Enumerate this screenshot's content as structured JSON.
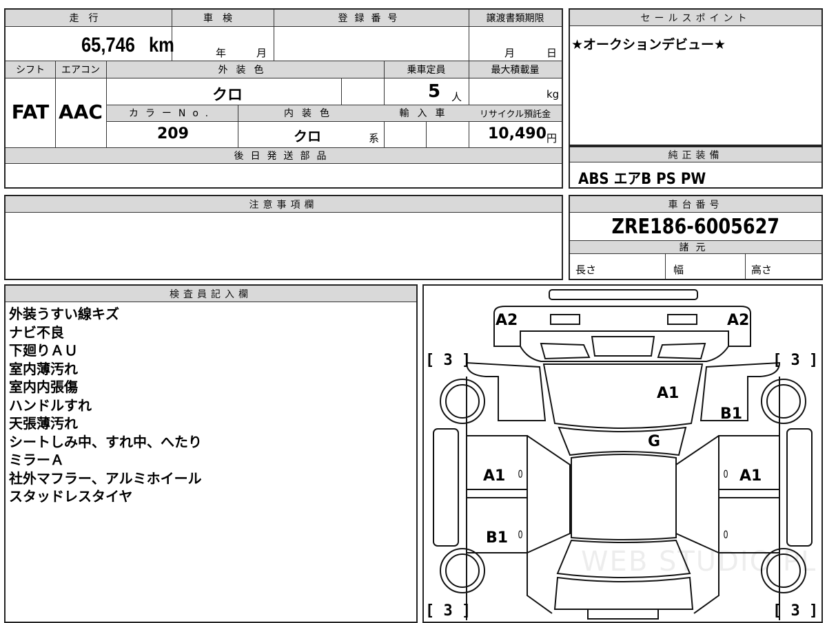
{
  "mileage": {
    "label": "走行",
    "value": "65,746",
    "unit": "km"
  },
  "shaken": {
    "label": "車検",
    "year_unit": "年",
    "month_unit": "月"
  },
  "registration": {
    "label": "登録番号"
  },
  "transfer_deadline": {
    "label": "譲渡書類期限",
    "month_unit": "月",
    "day_unit": "日"
  },
  "shift": {
    "label": "シフト",
    "value": "FAT"
  },
  "aircon": {
    "label": "エアコン",
    "value": "AAC"
  },
  "exterior_color": {
    "label": "外装色",
    "value": "クロ"
  },
  "capacity": {
    "label": "乗車定員",
    "value": "5",
    "unit": "人"
  },
  "max_load": {
    "label": "最大積載量",
    "unit": "kg"
  },
  "color_no": {
    "label": "カラーNo.",
    "value": "209"
  },
  "interior_color": {
    "label": "内装色",
    "value": "クロ",
    "suffix": "系"
  },
  "import": {
    "label": "輸入車"
  },
  "recycle": {
    "label": "リサイクル預託金",
    "value": "10,490",
    "unit": "円"
  },
  "later_parts": {
    "label": "後日発送部品"
  },
  "sales_point": {
    "label": "セールスポイント",
    "text": "★オークションデビュー★"
  },
  "equipment": {
    "label": "純正装備",
    "text": "ABS エアB PS PW"
  },
  "notes": {
    "label": "注意事項欄"
  },
  "chassis": {
    "label": "車台番号",
    "value": "ZRE186-6005627"
  },
  "specs": {
    "label": "諸元",
    "length": "長さ",
    "width": "幅",
    "height": "高さ"
  },
  "inspector": {
    "label": "検査員記入欄",
    "remarks": [
      "外装うすい線キズ",
      "ナビ不良",
      "下廻りＡＵ",
      "室内薄汚れ",
      "室内内張傷",
      "ハンドルすれ",
      "天張薄汚れ",
      "シートしみ中、すれ中、へたり",
      "ミラーＡ",
      "社外マフラー、アルミホイール",
      "スタッドレスタイヤ"
    ]
  },
  "diagram": {
    "marks": {
      "front_left": "A2",
      "front_right": "A2",
      "hood": "A1",
      "fender_right": "B1",
      "windshield": "G",
      "front_door_left": "A1",
      "front_door_right": "A1",
      "rear_door_left": "B1",
      "tire_fl": "[ 3 ]",
      "tire_fr": "[ 3 ]",
      "tire_rl": "[ 3 ]",
      "tire_rr": "[ 3 ]",
      "zero": "0"
    },
    "watermark": "WEB STUDIO PLUS"
  }
}
